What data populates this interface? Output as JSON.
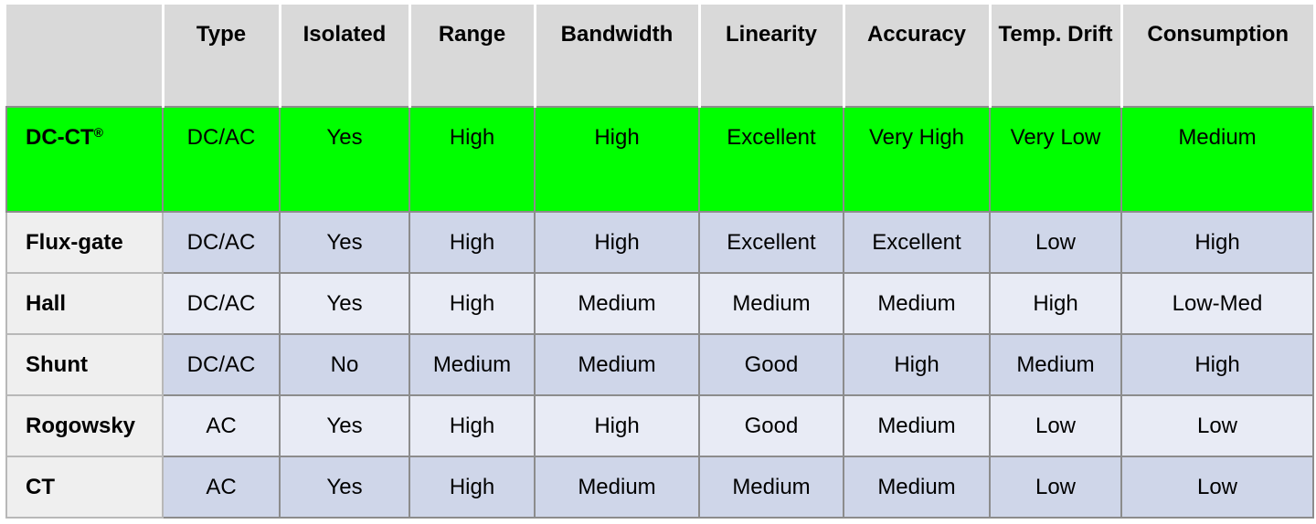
{
  "table": {
    "headers": [
      "",
      "Type",
      "Isolated",
      "Range",
      "Bandwidth",
      "Linearity",
      "Accuracy",
      "Temp. Drift",
      "Consumption"
    ],
    "rows": [
      {
        "name": "DC-CT",
        "mark": "®",
        "highlight": true,
        "cells": [
          "DC/AC",
          "Yes",
          "High",
          "High",
          "Excellent",
          "Very High",
          "Very Low",
          "Medium"
        ]
      },
      {
        "name": "Flux-gate",
        "mark": "",
        "cells": [
          "DC/AC",
          "Yes",
          "High",
          "High",
          "Excellent",
          "Excellent",
          "Low",
          "High"
        ]
      },
      {
        "name": "Hall",
        "mark": "",
        "cells": [
          "DC/AC",
          "Yes",
          "High",
          "Medium",
          "Medium",
          "Medium",
          "High",
          "Low-Med"
        ]
      },
      {
        "name": "Shunt",
        "mark": "",
        "cells": [
          "DC/AC",
          "No",
          "Medium",
          "Medium",
          "Good",
          "High",
          "Medium",
          "High"
        ]
      },
      {
        "name": "Rogowsky",
        "mark": "",
        "cells": [
          "AC",
          "Yes",
          "High",
          "High",
          "Good",
          "Medium",
          "Low",
          "Low"
        ]
      },
      {
        "name": "CT",
        "mark": "",
        "cells": [
          "AC",
          "Yes",
          "High",
          "Medium",
          "Medium",
          "Medium",
          "Low",
          "Low"
        ]
      }
    ]
  },
  "colors": {
    "header_bg": "#d9d9d9",
    "highlight_row": "#00ff00",
    "row_dark": "#cfd6e9",
    "row_light": "#e8ebf5",
    "row_header_bg": "#efefef"
  }
}
